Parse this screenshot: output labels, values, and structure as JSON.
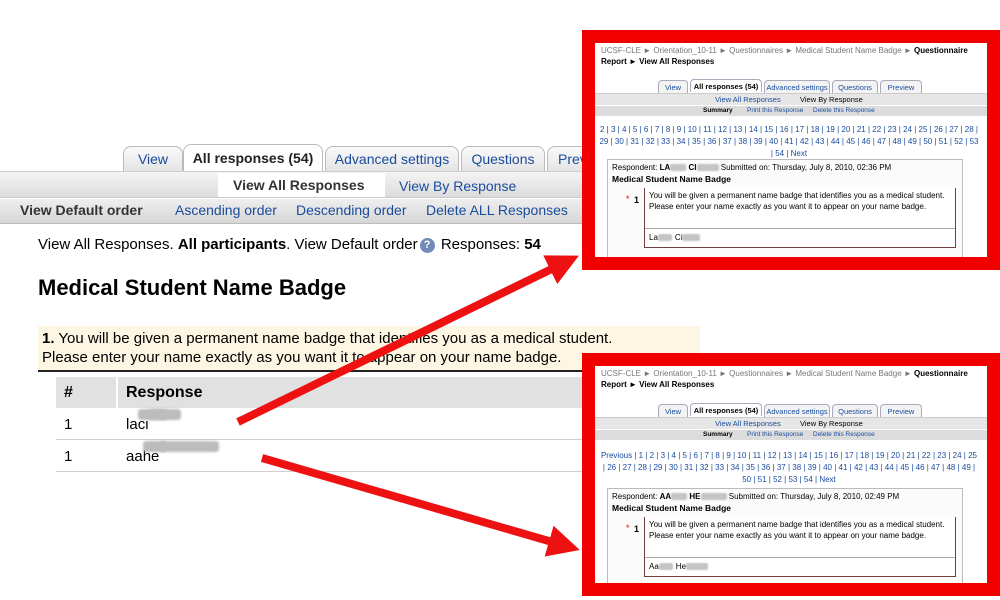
{
  "main": {
    "tabs": [
      {
        "label": "View",
        "active": false
      },
      {
        "label": "All responses (54)",
        "active": true
      },
      {
        "label": "Advanced settings",
        "active": false
      },
      {
        "label": "Questions",
        "active": false
      },
      {
        "label": "Prev",
        "active": false
      }
    ],
    "subtabs": {
      "view_all": "View All Responses",
      "by_response": "View By Response"
    },
    "order_links": {
      "current": "View Default order",
      "ascending": "Ascending order",
      "descending": "Descending order",
      "delete_all": "Delete ALL Responses"
    },
    "status": {
      "prefix": "View All Responses. ",
      "participants": "All participants",
      "middle": ". View Default order",
      "responses_label": "Responses: ",
      "responses_count": "54"
    },
    "question_title": "Medical Student Name Badge",
    "question": {
      "number": "1.",
      "line1": " You will be given a permanent name badge that identifies you as a medical student.",
      "line2": "Please enter your name exactly as you want it to appear on your name badge."
    },
    "table": {
      "headers": [
        "#",
        "Response"
      ],
      "rows": [
        {
          "num": "1",
          "first": "la",
          "last": "ci"
        },
        {
          "num": "1",
          "first": "aa",
          "last": "he"
        }
      ]
    }
  },
  "callouts": [
    {
      "breadcrumb_links": "UCSF-CLE ► Orientation_10-11 ► Questionnaires ► Medical Student Name Badge ► ",
      "breadcrumb_bold": "Questionnaire Report ► View All Responses",
      "tabs": [
        "View",
        "All responses (54)",
        "Advanced settings",
        "Questions",
        "Preview"
      ],
      "subtabs": [
        "View All Responses",
        "View By Response"
      ],
      "actions": [
        "Summary",
        "Print this Response",
        "Delete this Response"
      ],
      "pages": "2 | 3 | 4 | 5 | 6 | 7 | 8 | 9 | 10 | 11 | 12 | 13 | 14 | 15 | 16 | 17 | 18 | 19 | 20 | 21 | 22 | 23 | 24 | 25 | 26 | 27 | 28 | 29 | 30 | 31 | 32 | 33 | 34 | 35 | 36 | 37 | 38 | 39 | 40 | 41 | 42 | 43 | 44 | 45 | 46 | 47 | 48 | 49 | 50 | 51 | 52 | 53 | 54 | Next",
      "respondent_label": "Respondent: ",
      "respondent_first": "LA",
      "respondent_last": "CI",
      "submitted": "Submitted on: Thursday, July 8, 2010, 02:36 PM",
      "title": "Medical Student Name Badge",
      "qnum": "1",
      "qtext": "You will be given a permanent name badge that identifies you as a medical student. Please enter your name exactly as you want it to appear on your name badge.",
      "answer_first": "La",
      "answer_last": "Ci"
    },
    {
      "breadcrumb_links": "UCSF-CLE ► Orientation_10-11 ► Questionnaires ► Medical Student Name Badge ► ",
      "breadcrumb_bold": "Questionnaire Report ► View All Responses",
      "tabs": [
        "View",
        "All responses (54)",
        "Advanced settings",
        "Questions",
        "Preview"
      ],
      "subtabs": [
        "View All Responses",
        "View By Response"
      ],
      "actions": [
        "Summary",
        "Print this Response",
        "Delete this Response"
      ],
      "pages": "Previous | 1 | 2 | 3 | 4 | 5 | 6 | 7 | 8 | 9 | 10 | 11 | 12 | 13 | 14 | 15 | 16 | 17 | 18 | 19 | 20 | 21 | 22 | 23 | 24 | 25 | 26 | 27 | 28 | 29 | 30 | 31 | 32 | 33 | 34 | 35 | 36 | 37 | 38 | 39 | 40 | 41 | 42 | 43 | 44 | 45 | 46 | 47 | 48 | 49 | 50 | 51 | 52 | 53 | 54 | Next",
      "respondent_label": "Respondent: ",
      "respondent_first": "AA",
      "respondent_last": "HE",
      "submitted": "Submitted on: Thursday, July 8, 2010, 02:49 PM",
      "title": "Medical Student Name Badge",
      "qnum": "1",
      "qtext": "You will be given a permanent name badge that identifies you as a medical student. Please enter your name exactly as you want it to appear on your name badge.",
      "answer_first": "Aa",
      "answer_last": "He"
    }
  ],
  "colors": {
    "callout_border": "#f20000",
    "arrow": "#ee1111",
    "link": "#1a4c9c"
  }
}
